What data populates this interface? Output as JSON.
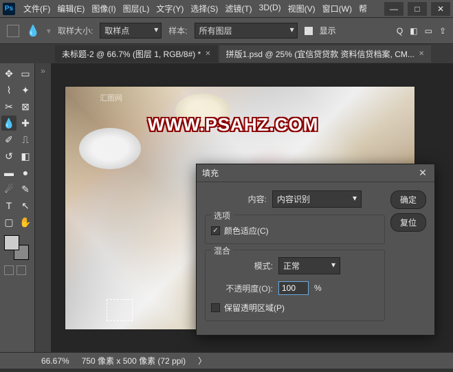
{
  "app": {
    "icon_text": "Ps"
  },
  "menu": {
    "file": "文件(F)",
    "edit": "编辑(E)",
    "image": "图像(I)",
    "layer": "图层(L)",
    "type": "文字(Y)",
    "select": "选择(S)",
    "filter": "滤镜(T)",
    "threed": "3D(D)",
    "view": "视图(V)",
    "window": "窗口(W)",
    "help": "帮"
  },
  "options": {
    "sample_size_label": "取样大小:",
    "sample_size_value": "取样点",
    "sample_label": "样本:",
    "sample_value": "所有图层",
    "show_label": "显示"
  },
  "tabs": {
    "active": "未标题-2 @ 66.7% (图层 1, RGB/8#) *",
    "inactive": "拼版1.psd @ 25% (宜信贷贷款 资料信贷档案, CM..."
  },
  "canvas": {
    "watermark": "WWW.PSAHZ.COM",
    "hui": "汇图网"
  },
  "dialog": {
    "title": "填充",
    "content_label": "内容:",
    "content_value": "内容识别",
    "ok": "确定",
    "reset": "复位",
    "options_section": "选项",
    "color_adapt": "颜色适应(C)",
    "blend_section": "混合",
    "mode_label": "模式:",
    "mode_value": "正常",
    "opacity_label": "不透明度(O):",
    "opacity_value": "100",
    "opacity_unit": "%",
    "preserve_trans": "保留透明区域(P)"
  },
  "status": {
    "zoom": "66.67%",
    "dims": "750 像素 x 500 像素 (72 ppi)"
  }
}
